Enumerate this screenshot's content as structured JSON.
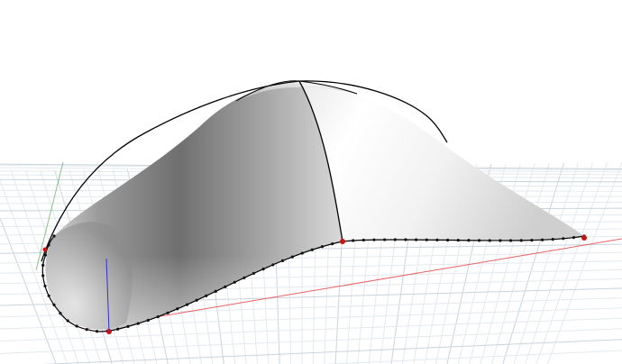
{
  "viewport": {
    "background": "#ffffff",
    "grid": {
      "visible": true,
      "major_color": "#c9d4dc",
      "minor_color": "#e3e9ee"
    },
    "axes": {
      "x_color": "#e03030",
      "y_color": "#3aa03a",
      "z_color": "#3030d0"
    }
  },
  "model": {
    "surface_colors": {
      "light": "#ffffff",
      "mid": "#c4c4c4",
      "dark": "#7a7a7a"
    },
    "curve_color": "#000000",
    "control_point_color": "#111111",
    "corner_point_color": "#cc1111"
  }
}
